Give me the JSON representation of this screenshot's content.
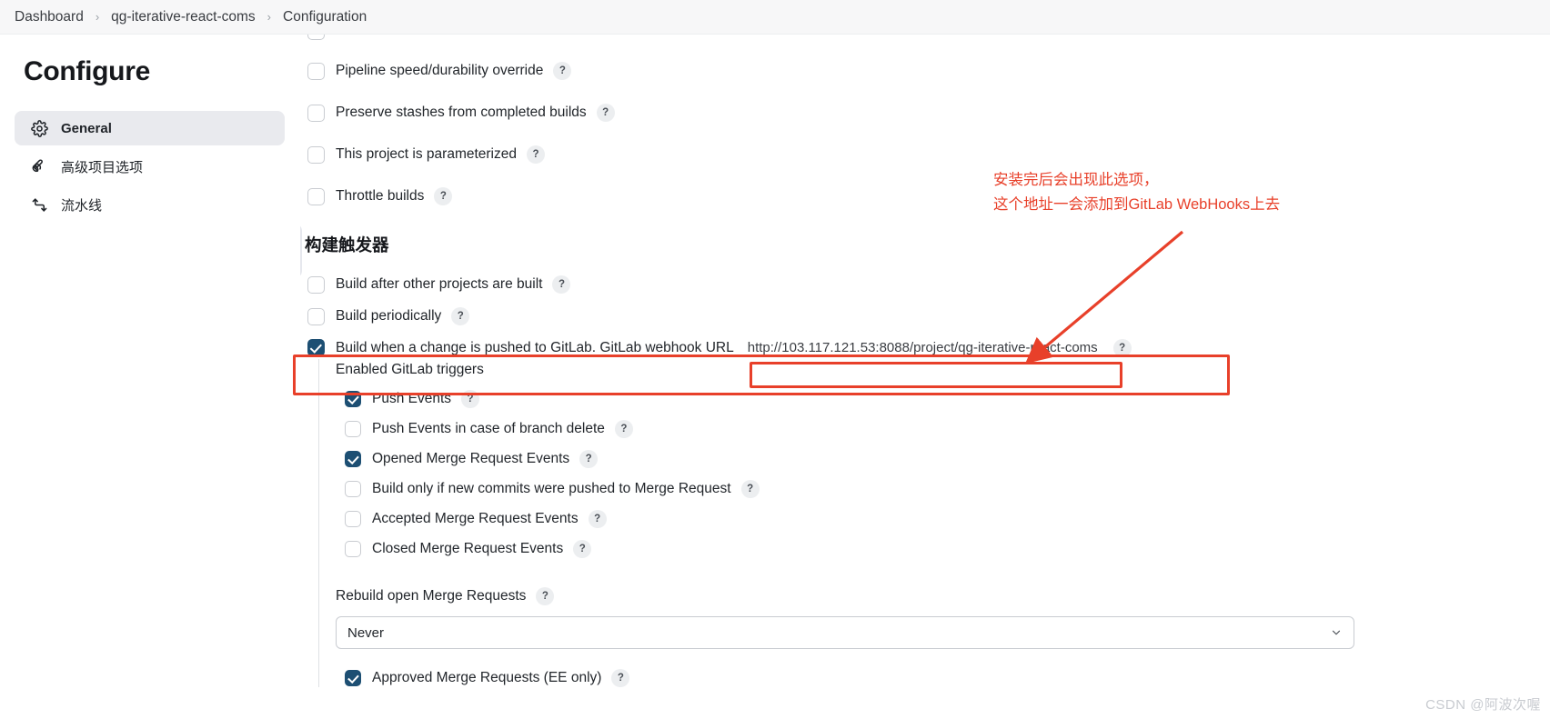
{
  "breadcrumb": {
    "items": [
      "Dashboard",
      "qg-iterative-react-coms",
      "Configuration"
    ],
    "separator": "›"
  },
  "sidebar": {
    "title": "Configure",
    "items": [
      {
        "label": "General",
        "icon": "gear-icon",
        "active": true
      },
      {
        "label": "高级项目选项",
        "icon": "wrench-icon",
        "active": false
      },
      {
        "label": "流水线",
        "icon": "pipeline-icon",
        "active": false
      }
    ]
  },
  "main": {
    "top_options": [
      {
        "label": "Pipeline speed/durability override",
        "checked": false,
        "help": "?"
      },
      {
        "label": "Preserve stashes from completed builds",
        "checked": false,
        "help": "?"
      },
      {
        "label": "This project is parameterized",
        "checked": false,
        "help": "?"
      },
      {
        "label": "Throttle builds",
        "checked": false,
        "help": "?"
      }
    ],
    "triggers_heading": "构建触发器",
    "trigger_options": [
      {
        "label": "Build after other projects are built",
        "checked": false,
        "help": "?"
      },
      {
        "label": "Build periodically",
        "checked": false,
        "help": "?"
      }
    ],
    "gitlab_trigger": {
      "label": "Build when a change is pushed to GitLab. GitLab webhook URL",
      "checked": true,
      "help": "?",
      "url_value": "http://103.117.121.53:8088/project/qg-iterative-react-coms"
    },
    "enabled_triggers_title": "Enabled GitLab triggers",
    "enabled_triggers": [
      {
        "label": "Push Events",
        "checked": true,
        "help": "?"
      },
      {
        "label": "Push Events in case of branch delete",
        "checked": false,
        "help": "?"
      },
      {
        "label": "Opened Merge Request Events",
        "checked": true,
        "help": "?"
      },
      {
        "label": "Build only if new commits were pushed to Merge Request",
        "checked": false,
        "help": "?"
      },
      {
        "label": "Accepted Merge Request Events",
        "checked": false,
        "help": "?"
      },
      {
        "label": "Closed Merge Request Events",
        "checked": false,
        "help": "?"
      }
    ],
    "rebuild": {
      "label": "Rebuild open Merge Requests",
      "help": "?",
      "selected": "Never"
    },
    "cut_off_option": {
      "label": "Approved Merge Requests (EE only)",
      "checked": true,
      "help": "?"
    }
  },
  "annotation": {
    "line1": "安装完后会出现此选项，",
    "line2": "这个地址一会添加到GitLab WebHooks上去",
    "color": "#e8402a"
  },
  "watermark": "CSDN @阿波次喔"
}
